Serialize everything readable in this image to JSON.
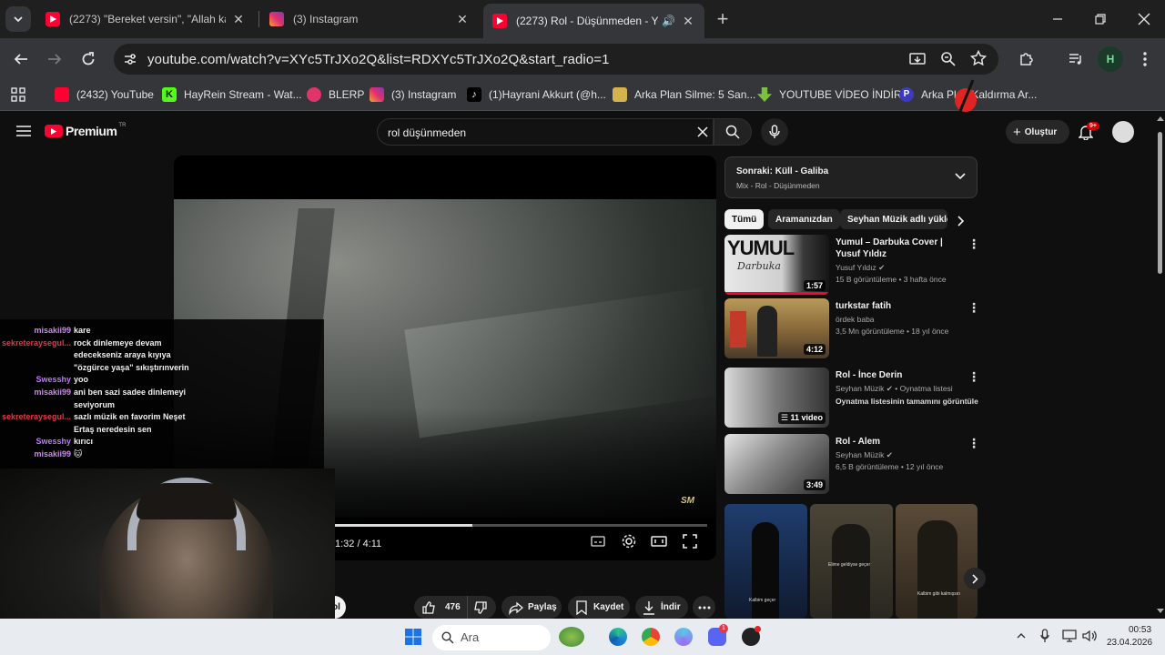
{
  "browser": {
    "tabs": [
      {
        "title": "(2273) \"Bereket versin\", \"Allah kaz",
        "active": false
      },
      {
        "title": "(3) Instagram",
        "active": false
      },
      {
        "title": "(2273) Rol - Düşünmeden - Yo",
        "active": true
      }
    ],
    "new_tab": "+",
    "url": "youtube.com/watch?v=XYc5TrJXo2Q&list=RDXYc5TrJXo2Q&start_radio=1",
    "profile_initial": "H",
    "bookmarks": [
      "(2432) YouTube",
      "HayRein Stream - Wat...",
      "BLERP",
      "(3) Instagram",
      "(1)Hayrani Akkurt (@h...",
      "Arka Plan Silme: 5 San...",
      "YOUTUBE VİDEO İNDİR",
      "Arka Plan Kaldırma Ar..."
    ]
  },
  "youtube": {
    "logo_text": "Premium",
    "logo_sup": "TR",
    "search_query": "rol düşünmeden",
    "create_label": "Oluştur",
    "notif_badge": "9+",
    "player": {
      "time": "1:32 / 4:11",
      "progress": 0.37,
      "watermark": "SM"
    },
    "actions": {
      "likes": "476",
      "share": "Paylaş",
      "save": "Kaydet",
      "download": "İndir",
      "channel_stub": "ol"
    },
    "next_up": {
      "title": "Sonraki: Küll - Galiba",
      "subtitle": "Mix - Rol - Düşünmeden"
    },
    "chips": [
      "Tümü",
      "Aramanızdan",
      "Seyhan Müzik adlı yükle"
    ],
    "related": [
      {
        "title": "Yumul – Darbuka Cover | Yusuf Yıldız",
        "channel": "Yusuf Yıldız",
        "verified": true,
        "meta": "15 B görüntüleme • 3 hafta önce",
        "duration": "1:57",
        "thumb_text": "YUMUL",
        "thumb_sub": "Darbuka"
      },
      {
        "title": "turkstar fatih",
        "channel": "ördek baba",
        "verified": false,
        "meta": "3,5 Mn görüntüleme • 18 yıl önce",
        "duration": "4:12"
      },
      {
        "title": "Rol - İnce Derin",
        "channel": "Seyhan Müzik",
        "verified": true,
        "channel_extra": " • Oynatma listesi",
        "meta": "Oynatma listesinin tamamını görüntüle",
        "duration": "11 video"
      },
      {
        "title": "Rol - Alem",
        "channel": "Seyhan Müzik",
        "verified": true,
        "meta": "6,5 B görüntüleme • 12 yıl önce",
        "duration": "3:49"
      }
    ],
    "shorts_captions": [
      "Kalbim geçer",
      "Elime geldiyse geçer",
      "Kalbim gibi kalmışsın"
    ]
  },
  "chat": [
    {
      "user": "misakii99",
      "color": "#c58ce6",
      "msg": "kare"
    },
    {
      "user": "sekreteraysegul...",
      "color": "#e0394a",
      "msg": "rock dinlemeye devam"
    },
    {
      "user": "",
      "color": "#ffffff",
      "msg": "edecekseniz araya kıyıya"
    },
    {
      "user": "",
      "color": "#ffffff",
      "msg": "\"özgürce yaşa\" sıkıştırınverin"
    },
    {
      "user": "Swesshy",
      "color": "#b97cf2",
      "msg": "yoo"
    },
    {
      "user": "misakii99",
      "color": "#c58ce6",
      "msg": "ani ben sazi sadee dinlemeyi"
    },
    {
      "user": "",
      "color": "#ffffff",
      "msg": "seviyorum"
    },
    {
      "user": "sekreteraysegul...",
      "color": "#e0394a",
      "msg": "sazlı müzik en favorim Neşet"
    },
    {
      "user": "",
      "color": "#ffffff",
      "msg": "Ertaş neredesin sen"
    },
    {
      "user": "Swesshy",
      "color": "#b97cf2",
      "msg": "kırıcı"
    },
    {
      "user": "misakii99",
      "color": "#c58ce6",
      "msg": "🐱"
    }
  ],
  "taskbar": {
    "search_placeholder": "Ara",
    "time": "00:53",
    "date": "23.04.2026",
    "discord_badge": "1"
  }
}
